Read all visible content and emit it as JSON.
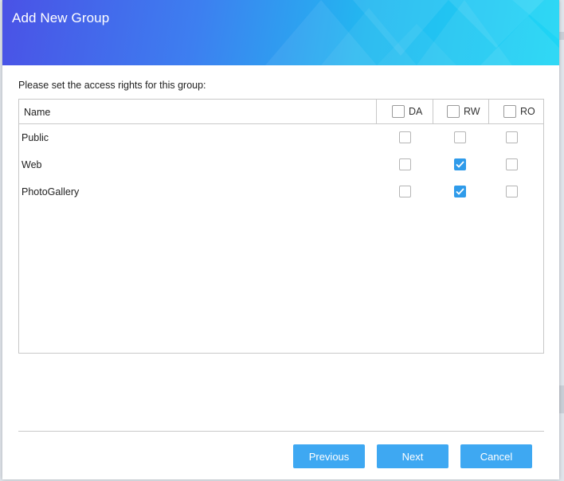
{
  "dialog": {
    "title": "Add New Group",
    "instruction": "Please set the access rights for this group:"
  },
  "table": {
    "columns": {
      "name": "Name",
      "da": "DA",
      "rw": "RW",
      "ro": "RO"
    },
    "header_checks": {
      "da": false,
      "rw": false,
      "ro": false
    },
    "rows": [
      {
        "name": "Public",
        "da": false,
        "rw": false,
        "ro": false
      },
      {
        "name": "Web",
        "da": false,
        "rw": true,
        "ro": false
      },
      {
        "name": "PhotoGallery",
        "da": false,
        "rw": true,
        "ro": false
      }
    ]
  },
  "buttons": {
    "previous": "Previous",
    "next": "Next",
    "cancel": "Cancel"
  },
  "colors": {
    "accent": "#3ea8f2",
    "checkbox_checked": "#2f9bea",
    "header_gradient_start": "#4a52e6",
    "header_gradient_end": "#1fd6f5"
  }
}
